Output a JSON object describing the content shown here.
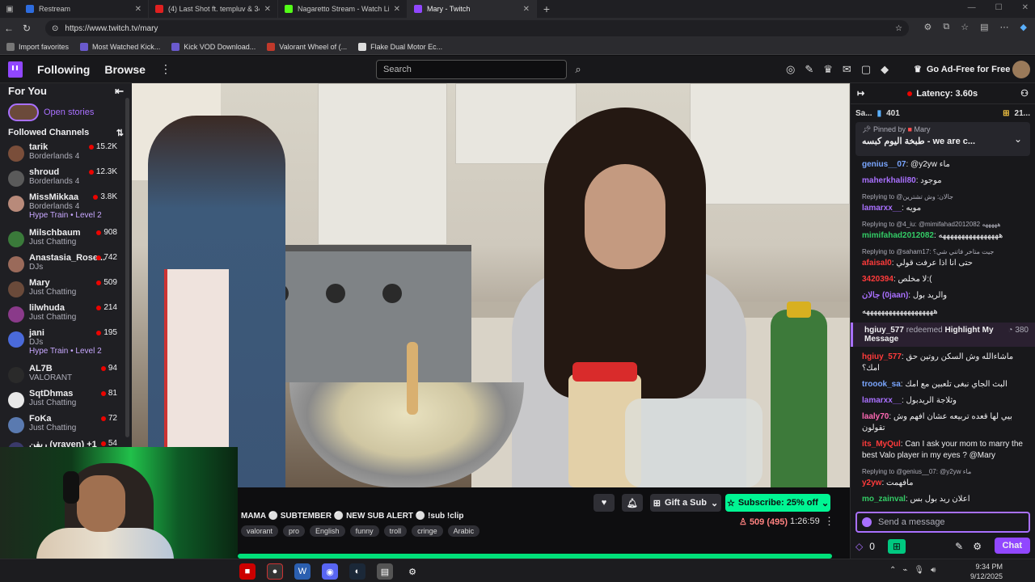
{
  "browser": {
    "tabs": [
      {
        "title": "Restream",
        "color": "#2d6cdf"
      },
      {
        "title": "(4) Last Shot ft. templuv & 347aid",
        "color": "#e02020"
      },
      {
        "title": "Nagaretto Stream - Watch Live o",
        "color": "#53fc18"
      },
      {
        "title": "Mary - Twitch",
        "color": "#9147ff"
      }
    ],
    "url": "https://www.twitch.tv/mary",
    "bookmarks": [
      "Import favorites",
      "Most Watched Kick...",
      "Kick VOD Download...",
      "Valorant Wheel of (...",
      "Flake Dual Motor Ec..."
    ]
  },
  "twitch": {
    "nav": {
      "following": "Following",
      "browse": "Browse",
      "search_placeholder": "Search",
      "adfree": "Go Ad-Free for Free"
    },
    "sidebar": {
      "for_you": "For You",
      "open_stories": "Open stories",
      "followed_channels": "Followed Channels",
      "channels": [
        {
          "name": "tarik",
          "game": "Borderlands 4",
          "viewers": "15.2K",
          "color": "#7a4e3a"
        },
        {
          "name": "shroud",
          "game": "Borderlands 4",
          "viewers": "12.3K",
          "color": "#5a5a5a"
        },
        {
          "name": "MissMikkaa",
          "game": "Borderlands 4",
          "viewers": "3.8K",
          "color": "#b88a7a",
          "hype": "Hype Train • Level 2"
        },
        {
          "name": "Milschbaum",
          "game": "Just Chatting",
          "viewers": "908",
          "color": "#3a7a3a"
        },
        {
          "name": "Anastasia_Rose...",
          "game": "DJs",
          "viewers": "742",
          "color": "#9a6a5a"
        },
        {
          "name": "Mary",
          "game": "Just Chatting",
          "viewers": "509",
          "color": "#6a4a3a"
        },
        {
          "name": "lilwhuda",
          "game": "Just Chatting",
          "viewers": "214",
          "color": "#8a3a8a"
        },
        {
          "name": "jani",
          "game": "DJs",
          "viewers": "195",
          "color": "#4a6ada",
          "hype": "Hype Train • Level 2"
        },
        {
          "name": "AL7B",
          "game": "VALORANT",
          "viewers": "94",
          "color": "#2a2a2a"
        },
        {
          "name": "SqtDhmas",
          "game": "Just Chatting",
          "viewers": "81",
          "color": "#e8e8e8"
        },
        {
          "name": "FoKa",
          "game": "Just Chatting",
          "viewers": "72",
          "color": "#5a7ab0"
        },
        {
          "name": "ريفن (vraven) +1",
          "game": "VALORANT",
          "viewers": "54",
          "color": "#3a3a6a"
        }
      ]
    },
    "stream": {
      "title": "MAMA ⚪ SUBTEMBER ⚪ NEW SUB ALERT ⚪ !sub !clip",
      "tags": [
        "valorant",
        "pro",
        "English",
        "funny",
        "troll",
        "cringe",
        "Arabic"
      ],
      "gift": "Gift a Sub",
      "subscribe": "Subscribe: 25% off",
      "viewers": "509 (495)",
      "uptime": "1:26:59"
    },
    "chat": {
      "latency": "Latency: 3.60s",
      "leader_left": "Sa...",
      "leader_count": "401",
      "leader_right": "21...",
      "pinned_by": "Pinned by",
      "pinned_user": "Mary",
      "pinned_text": "طبخة اليوم كبسه - we are c...",
      "messages": [
        {
          "user": "genius__07",
          "color": "#7aa6ff",
          "text": ": @y2yw ماء"
        },
        {
          "user": "maherkhalil80",
          "color": "#a970ff",
          "text": ": موجود"
        },
        {
          "reply": "Replying to @جالان: وش تشترين",
          "user": "lamarxx__",
          "color": "#a970ff",
          "text": ": مويه"
        },
        {
          "reply": "Replying to @4_iu: @mimifahad2012082 هههههه",
          "user": "mimifahad2012082",
          "color": "#33cc66",
          "text": ": ههههههههههههههههه"
        },
        {
          "reply": "Replying to @saham17: جيت متاخر فاتني شي؟",
          "user": "afaisal0",
          "color": "#ff3b3b",
          "text": ": حتى انا اذا عرفت قولي"
        },
        {
          "user": "3420394",
          "color": "#ff3b3b",
          "text": ": لا مخلص:("
        },
        {
          "user": "جالان (0jaan)",
          "color": "#a970ff",
          "text": ": والريد بول"
        },
        {
          "user": "",
          "color": "#efeff1",
          "text": "هههههههههههههههههههه"
        }
      ],
      "redeem": {
        "user": "hgiuy_577",
        "action": "redeemed",
        "reward": "Highlight My Message",
        "points": "380"
      },
      "messages2": [
        {
          "user": "hgiuy_577",
          "color": "#ff3b3b",
          "text": ": ماشاءالله وش السكن روتين حق امك؟"
        },
        {
          "user": "troook_sa",
          "color": "#7aa6ff",
          "text": ": البث الجاي نبغى تلعبين مع امك"
        },
        {
          "user": "lamarxx__",
          "color": "#a970ff",
          "text": ": وثلاجة الريدبول"
        },
        {
          "user": "laaly70",
          "color": "#ff69b4",
          "text": ": بيي لها قعده تربيعه عشان افهم وش تقولون"
        },
        {
          "user": "its_MyQul",
          "color": "#ff3b3b",
          "text": ": Can I ask your mom to marry the best Valo player in my eyes ? @Mary"
        },
        {
          "reply": "Replying to @genius__07: @y2yw ماء",
          "user": "y2yw",
          "color": "#ff3b3b",
          "text": ": مافهمت"
        },
        {
          "user": "mo_zainval",
          "color": "#33cc66",
          "text": ": اعلان ريد بول بس"
        }
      ],
      "input_placeholder": "Send a message",
      "points": "0",
      "chat_button": "Chat"
    }
  },
  "taskbar": {
    "time": "9:34 PM",
    "date": "9/12/2025"
  }
}
